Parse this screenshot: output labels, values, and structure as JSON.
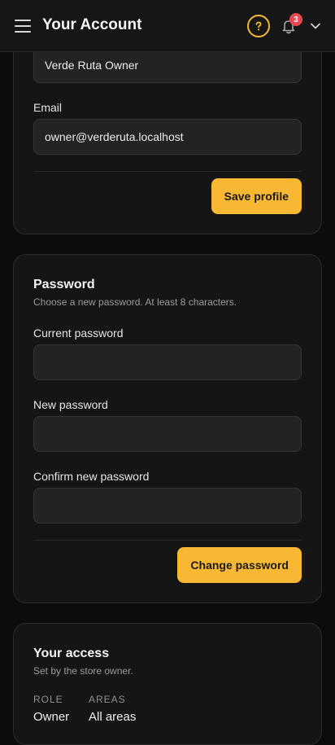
{
  "header": {
    "title": "Your Account",
    "notification_count": "3",
    "accent": "#f5b731",
    "badge_color": "#e5484d",
    "menu_icon": "hamburger-icon",
    "help_icon": "help-circle-icon",
    "bell_icon": "bell-icon",
    "chevron_icon": "chevron-down-icon"
  },
  "profile": {
    "name_value": "Verde Ruta Owner",
    "email_label": "Email",
    "email_value": "owner@verderuta.localhost",
    "save_label": "Save profile"
  },
  "password": {
    "title": "Password",
    "subtitle": "Choose a new password. At least 8 characters.",
    "current_label": "Current password",
    "new_label": "New password",
    "confirm_label": "Confirm new password",
    "submit_label": "Change password"
  },
  "access": {
    "title": "Your access",
    "subtitle": "Set by the store owner.",
    "role_label": "ROLE",
    "role_value": "Owner",
    "areas_label": "AREAS",
    "areas_value": "All areas"
  }
}
